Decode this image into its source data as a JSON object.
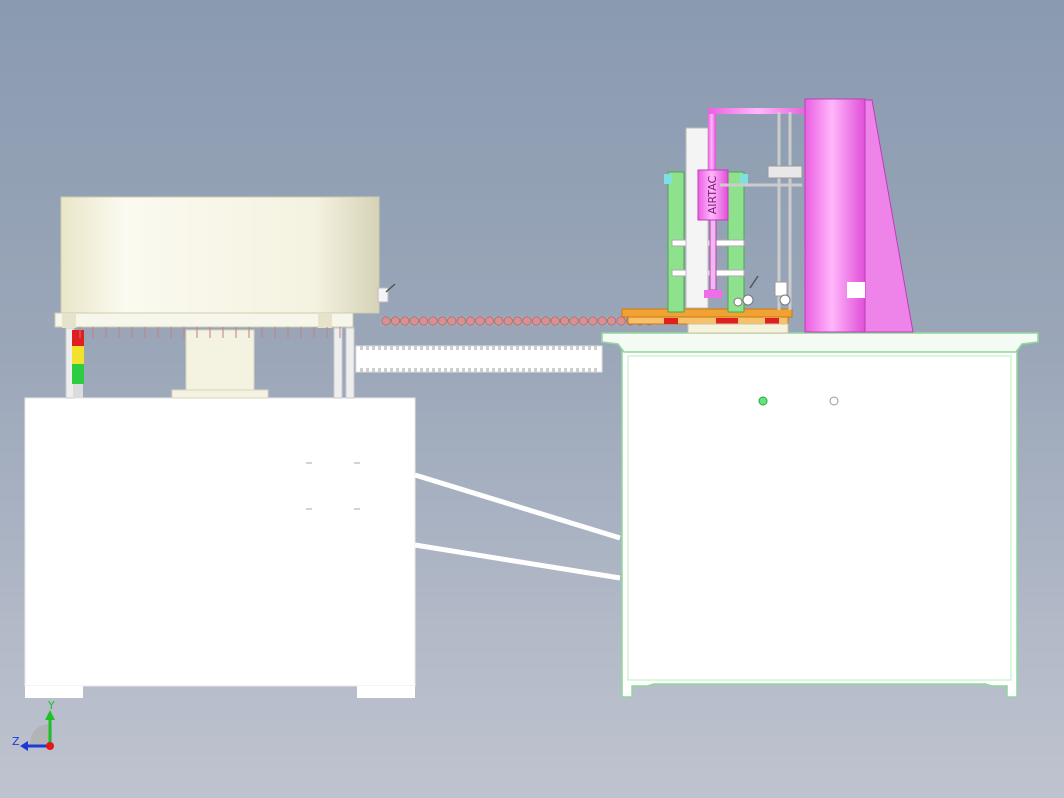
{
  "view": {
    "background_top": "#8a9ab0",
    "background_bottom": "#bfc3cf"
  },
  "triad": {
    "y_label": "Y",
    "z_label": "Z",
    "y_color": "#1fbf2a",
    "z_color": "#1a3bd6",
    "x_color": "#e01818"
  },
  "labels": {
    "cylinder_text": "AIRTAC"
  },
  "colors": {
    "feeder_body": "#f2f0dc",
    "cabinet": "#ffffff",
    "frame_outline": "#8fd89a",
    "magenta": "#ee6ee8",
    "orange": "#f2a233",
    "balls": "#d89090",
    "green_frame": "#8ee28e",
    "signal_green": "#2ecc40",
    "signal_yellow": "#f2e22c",
    "signal_red": "#e02020"
  },
  "feed_track": {
    "ball_count": 29
  }
}
